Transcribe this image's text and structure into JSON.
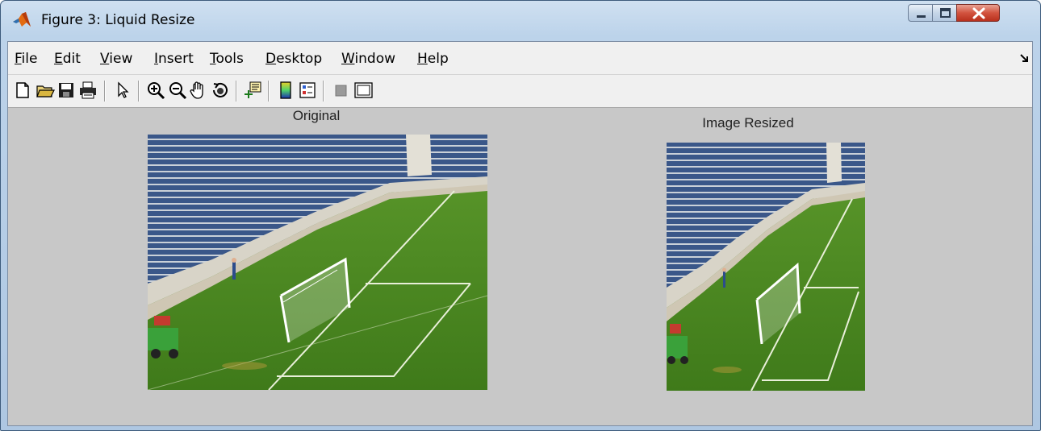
{
  "window": {
    "title": "Figure 3: Liquid Resize",
    "controls": {
      "minimize_icon": "minimize-icon",
      "maximize_icon": "maximize-icon",
      "close_icon": "close-icon"
    }
  },
  "menu": {
    "items": [
      {
        "label": "File"
      },
      {
        "label": "Edit"
      },
      {
        "label": "View"
      },
      {
        "label": "Insert"
      },
      {
        "label": "Tools"
      },
      {
        "label": "Desktop"
      },
      {
        "label": "Window"
      },
      {
        "label": "Help"
      }
    ]
  },
  "toolbar": {
    "buttons": [
      {
        "icon": "new-figure-icon"
      },
      {
        "icon": "open-file-icon"
      },
      {
        "icon": "save-icon"
      },
      {
        "icon": "print-icon"
      },
      {
        "icon": "select-arrow-icon"
      },
      {
        "icon": "zoom-in-icon"
      },
      {
        "icon": "zoom-out-icon"
      },
      {
        "icon": "pan-hand-icon"
      },
      {
        "icon": "rotate-3d-icon"
      },
      {
        "icon": "data-cursor-icon"
      },
      {
        "icon": "colorbar-icon"
      },
      {
        "icon": "legend-icon"
      },
      {
        "icon": "hide-plot-tools-icon"
      },
      {
        "icon": "show-plot-tools-icon"
      }
    ]
  },
  "axes": [
    {
      "title": "Original",
      "image": "soccer-stadium-goal-photo"
    },
    {
      "title": "Image Resized",
      "image": "soccer-stadium-goal-photo-resized"
    }
  ],
  "colors": {
    "client_bg": "#c8c8c8",
    "menubar_bg": "#f0f0f0",
    "grass": "#4e8a22",
    "seats": "#3c5a8c"
  }
}
